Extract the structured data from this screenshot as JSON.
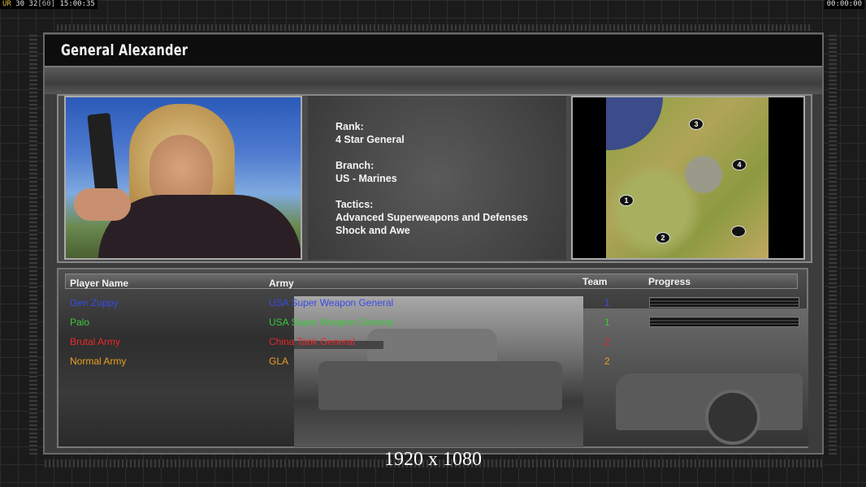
{
  "hud": {
    "ur": "UR",
    "fps1": "30",
    "fps2": "32",
    "fps3": "[60]",
    "clock": "15:00:35",
    "timer": "00:00:00"
  },
  "general": {
    "name": "General Alexander"
  },
  "info": {
    "rank_label": "Rank:",
    "rank_value": "4 Star General",
    "branch_label": "Branch:",
    "branch_value": "US - Marines",
    "tactics_label": "Tactics:",
    "tactics_line1": "Advanced Superweapons and Defenses",
    "tactics_line2": "Shock and Awe"
  },
  "map": {
    "markers": [
      "1",
      "2",
      "3",
      "4"
    ]
  },
  "table": {
    "headers": {
      "player": "Player Name",
      "army": "Army",
      "team": "Team",
      "progress": "Progress"
    },
    "rows": [
      {
        "player": "Gen Zuppy",
        "army": "USA Super Weapon General",
        "team": "1",
        "color": "#3a4ae8",
        "has_progress": true
      },
      {
        "player": "Palo",
        "army": "USA Super Weapon General",
        "team": "1",
        "color": "#3ac83a",
        "army_color": "#3ac83a",
        "has_progress": true
      },
      {
        "player": "Brutal Army",
        "army": "China Tank General",
        "team": "2",
        "color": "#e82a2a",
        "has_progress": false
      },
      {
        "player": "Normal Army",
        "army": "GLA",
        "team": "2",
        "color": "#e8a020",
        "has_progress": false
      }
    ]
  },
  "footer": {
    "resolution": "1920 x 1080"
  },
  "colors": {
    "blue": "#3a4ae8",
    "green": "#3ac83a",
    "red": "#e82a2a",
    "orange": "#e8a020"
  }
}
